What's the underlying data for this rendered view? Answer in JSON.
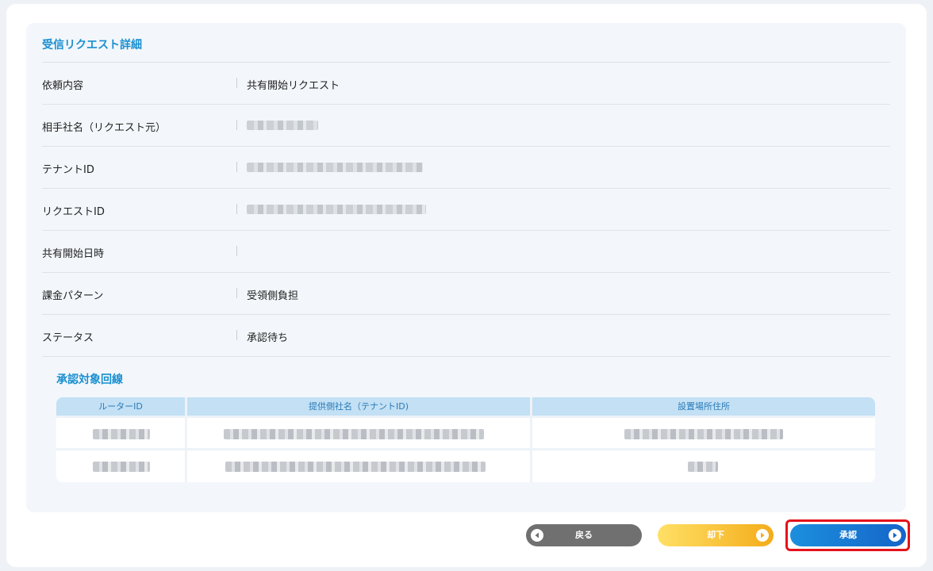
{
  "panel": {
    "title": "受信リクエスト詳細",
    "rows": [
      {
        "label": "依頼内容",
        "value": "共有開始リクエスト"
      },
      {
        "label": "相手社名（リクエスト元）",
        "value": ""
      },
      {
        "label": "テナントID",
        "value": ""
      },
      {
        "label": "リクエストID",
        "value": ""
      },
      {
        "label": "共有開始日時",
        "value": ""
      },
      {
        "label": "課金パターン",
        "value": "受領側負担"
      },
      {
        "label": "ステータス",
        "value": "承認待ち"
      }
    ]
  },
  "lines": {
    "title": "承認対象回線",
    "columns": [
      "ルーターID",
      "提供側社名（テナントID)",
      "設置場所住所"
    ]
  },
  "buttons": {
    "back": "戻る",
    "reject": "却下",
    "approve": "承認"
  },
  "colors": {
    "accent": "#1a8fd1",
    "highlight": "#e5121a",
    "back_button": "#707070",
    "reject_button": "#f4ac1a",
    "approve_button": "#1565c8"
  }
}
